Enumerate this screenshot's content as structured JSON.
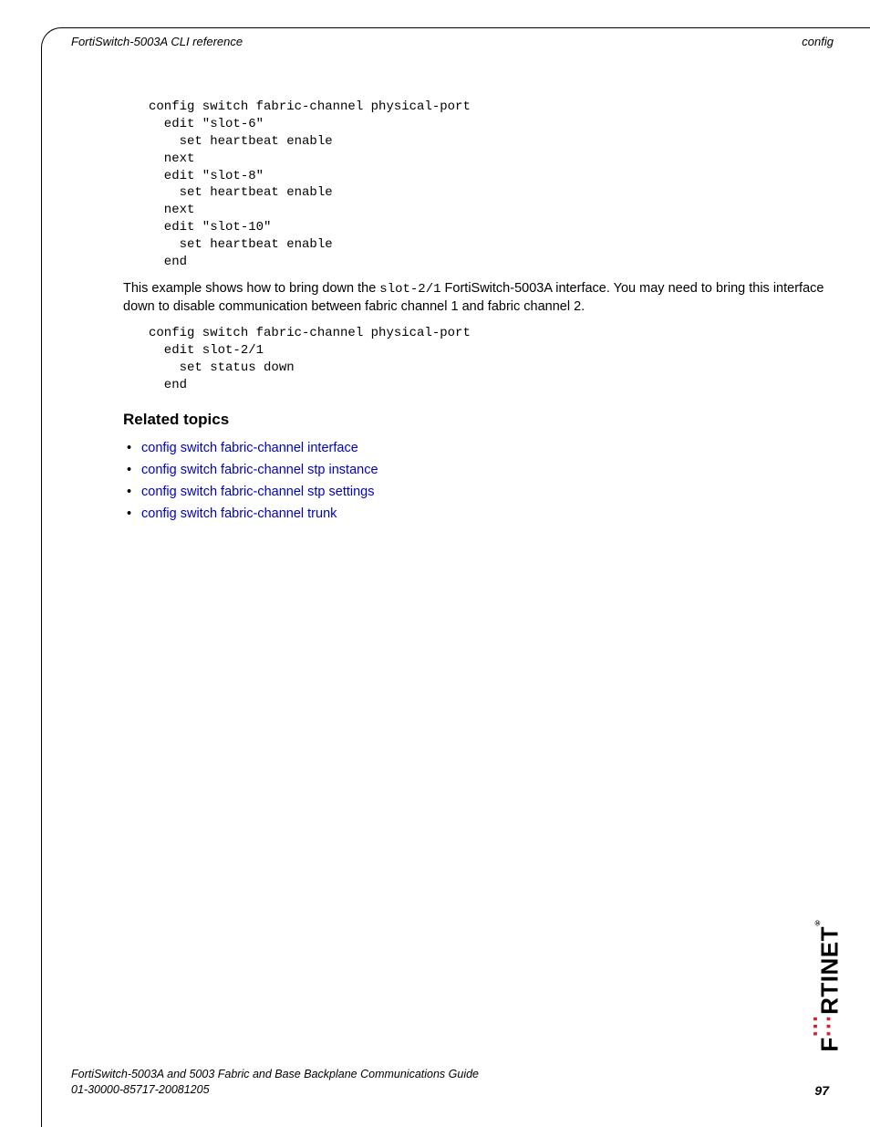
{
  "header": {
    "left": "FortiSwitch-5003A CLI reference",
    "right": "config"
  },
  "code_block_1": "config switch fabric-channel physical-port\n  edit \"slot-6\"\n    set heartbeat enable\n  next\n  edit \"slot-8\"\n    set heartbeat enable\n  next\n  edit \"slot-10\"\n    set heartbeat enable\n  end",
  "paragraph_1_pre": "This example shows how to bring down the ",
  "paragraph_1_code": "slot-2/1",
  "paragraph_1_post": " FortiSwitch-5003A interface. You may need to bring this interface down to disable communication between fabric channel 1 and fabric channel 2.",
  "code_block_2": "config switch fabric-channel physical-port\n  edit slot-2/1\n    set status down\n  end",
  "related_topics_heading": "Related topics",
  "related_topics": [
    "config switch fabric-channel interface",
    "config switch fabric-channel stp instance",
    "config switch fabric-channel stp settings",
    "config switch fabric-channel trunk"
  ],
  "footer": {
    "line1": "FortiSwitch-5003A and 5003   Fabric and Base Backplane Communications Guide",
    "line2": "01-30000-85717-20081205",
    "page": "97"
  },
  "logo": {
    "text_pre": "F",
    "text_post": "RTINET"
  }
}
